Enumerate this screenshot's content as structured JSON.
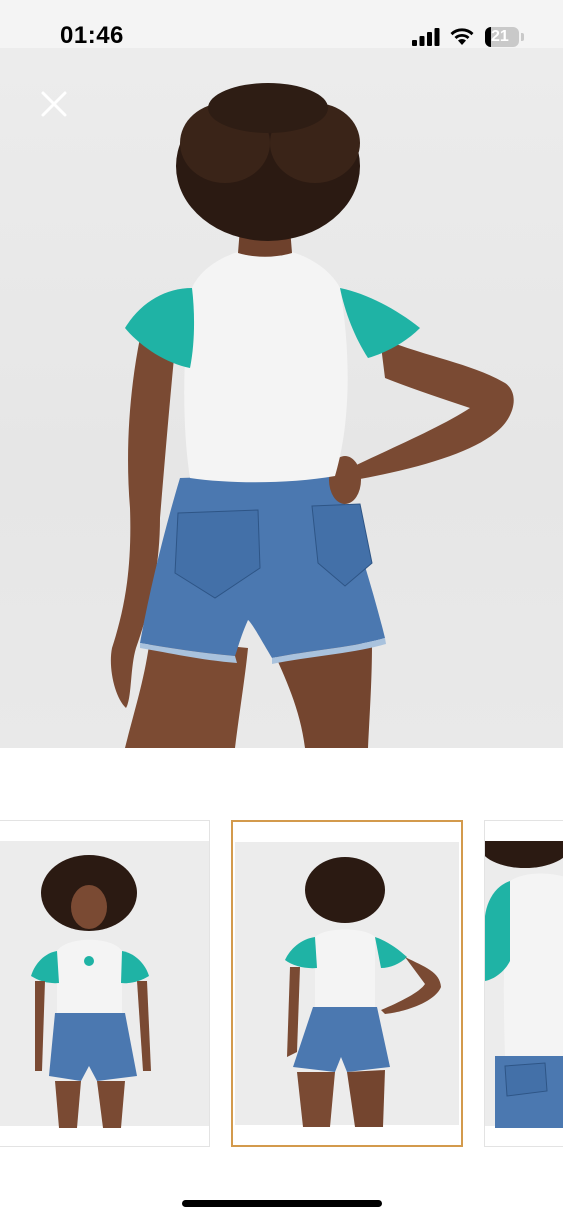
{
  "status_bar": {
    "time": "01:46",
    "battery_level": "21",
    "icons": [
      "cellular-signal-icon",
      "wifi-icon",
      "battery-icon"
    ]
  },
  "viewer": {
    "close_icon": "close-icon",
    "image": "product-photo-back-view"
  },
  "thumbnails": {
    "items": [
      {
        "view": "front",
        "selected": false
      },
      {
        "view": "back",
        "selected": true
      },
      {
        "view": "side-closeup",
        "selected": false
      }
    ],
    "selected_color": "#d39a4c"
  },
  "colors": {
    "sleeve": "#1fb3a5",
    "shirt": "#f4f4f4",
    "denim": "#4b78b0",
    "skin": "#7a4a33",
    "hair": "#2b1a12"
  }
}
